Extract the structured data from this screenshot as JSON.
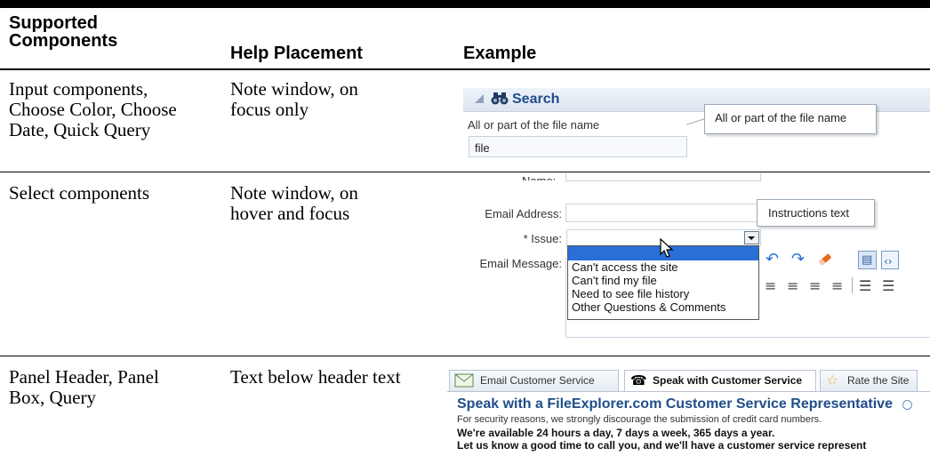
{
  "table": {
    "headers": {
      "col1": "Supported\nComponents",
      "col2": "Help Placement",
      "col3": "Example"
    },
    "rows": [
      {
        "components": "Input components,\nChoose Color, Choose\nDate, Quick Query",
        "placement": "Note window, on\nfocus only"
      },
      {
        "components": "Select components",
        "placement": "Note window, on\nhover and focus"
      },
      {
        "components": "Panel Header, Panel\nBox, Query",
        "placement": "Text below header text"
      }
    ]
  },
  "example1": {
    "panel_title": "Search",
    "field_label": "All or part of the file name",
    "field_value": "file",
    "note_text": "All or part of the file name"
  },
  "example2": {
    "name_label": "Name:",
    "email_label": "Email Address:",
    "issue_label": "* Issue:",
    "message_label": "Email Message:",
    "note_text": "Instructions text",
    "options": [
      "",
      "Can't access the site",
      "Can't find my file",
      "Need to see file history",
      "Other Questions & Comments"
    ]
  },
  "example3": {
    "tabs": [
      "Email Customer Service",
      "Speak with Customer Service",
      "Rate the Site"
    ],
    "header": "Speak with a FileExplorer.com Customer Service Representative",
    "line1": "For security reasons, we strongly discourage the submission of credit card numbers.",
    "line2": "We're available 24 hours a day, 7 days a week, 365 days a year.",
    "line3": "Let us know a good time to call you, and we'll have a customer service represent"
  },
  "icons": {
    "binoculars": "binoculars-icon",
    "cursor": "mouse-pointer-icon",
    "help": "help-icon",
    "envelope": "envelope-icon",
    "phone": "phone-icon",
    "star": "star-icon"
  },
  "colors": {
    "link_blue": "#1f4d8a",
    "selection_blue": "#2a6fd6"
  }
}
